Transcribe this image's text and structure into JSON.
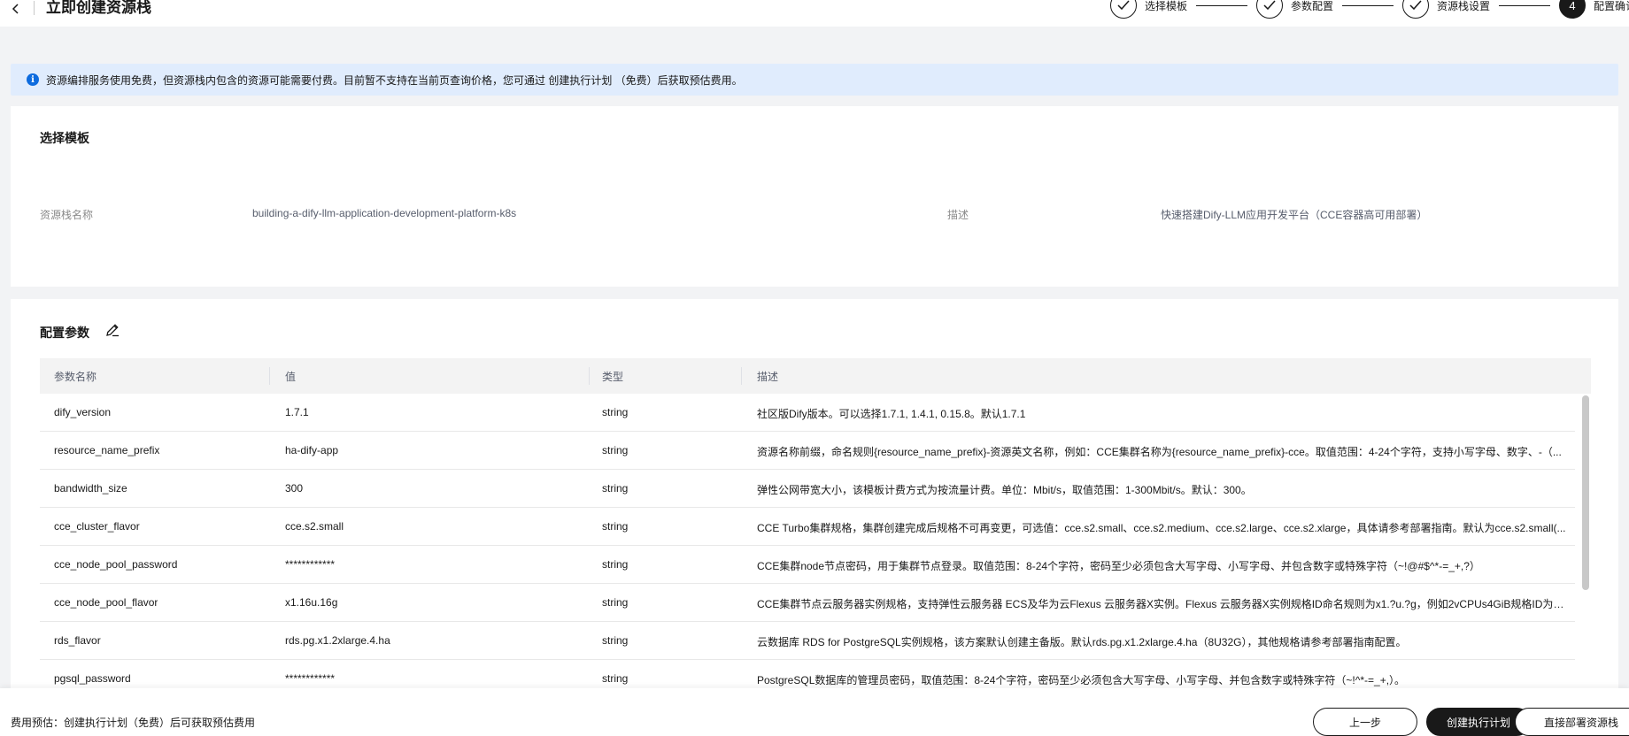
{
  "header": {
    "title": "立即创建资源栈",
    "steps": [
      {
        "label": "选择模板",
        "state": "done"
      },
      {
        "label": "参数配置",
        "state": "done"
      },
      {
        "label": "资源栈设置",
        "state": "done"
      },
      {
        "label": "配置确认",
        "number": "4",
        "state": "active"
      }
    ]
  },
  "banner": {
    "text": "资源编排服务使用免费，但资源栈内包含的资源可能需要付费。目前暂不支持在当前页查询价格，您可通过 创建执行计划 （免费）后获取预估费用。"
  },
  "template_section": {
    "title": "选择模板",
    "stack_name_label": "资源栈名称",
    "stack_name_value": "building-a-dify-llm-application-development-platform-k8s",
    "desc_label": "描述",
    "desc_value": "快速搭建Dify-LLM应用开发平台（CCE容器高可用部署）"
  },
  "params_section": {
    "title": "配置参数",
    "columns": [
      "参数名称",
      "值",
      "类型",
      "描述"
    ],
    "rows": [
      {
        "name": "dify_version",
        "value": "1.7.1",
        "type": "string",
        "desc": "社区版Dify版本。可以选择1.7.1, 1.4.1, 0.15.8。默认1.7.1"
      },
      {
        "name": "resource_name_prefix",
        "value": "ha-dify-app",
        "type": "string",
        "desc": "资源名称前缀，命名规则{resource_name_prefix}-资源英文名称，例如：CCE集群名称为{resource_name_prefix}-cce。取值范围：4-24个字符，支持小写字母、数字、-（..."
      },
      {
        "name": "bandwidth_size",
        "value": "300",
        "type": "string",
        "desc": "弹性公网带宽大小，该模板计费方式为按流量计费。单位：Mbit/s，取值范围：1-300Mbit/s。默认：300。"
      },
      {
        "name": "cce_cluster_flavor",
        "value": "cce.s2.small",
        "type": "string",
        "desc": "CCE Turbo集群规格，集群创建完成后规格不可再变更，可选值：cce.s2.small、cce.s2.medium、cce.s2.large、cce.s2.xlarge，具体请参考部署指南。默认为cce.s2.small(..."
      },
      {
        "name": "cce_node_pool_password",
        "value": "************",
        "type": "string",
        "desc": "CCE集群node节点密码，用于集群节点登录。取值范围：8-24个字符，密码至少必须包含大写字母、小写字母、并包含数字或特殊字符（~!@#$^*-=_+,?）"
      },
      {
        "name": "cce_node_pool_flavor",
        "value": "x1.16u.16g",
        "type": "string",
        "desc": "CCE集群节点云服务器实例规格，支持弹性云服务器 ECS及华为云Flexus 云服务器X实例。Flexus 云服务器X实例规格ID命名规则为x1.?u.?g，例如2vCPUs4GiB规格ID为x..."
      },
      {
        "name": "rds_flavor",
        "value": "rds.pg.x1.2xlarge.4.ha",
        "type": "string",
        "desc": "云数据库 RDS for PostgreSQL实例规格，该方案默认创建主备版。默认rds.pg.x1.2xlarge.4.ha（8U32G），其他规格请参考部署指南配置。"
      },
      {
        "name": "pgsql_password",
        "value": "************",
        "type": "string",
        "desc": "PostgreSQL数据库的管理员密码，取值范围：8-24个字符，密码至少必须包含大写字母、小写字母、并包含数字或特殊字符（~!^*-=_+,）。"
      }
    ]
  },
  "footer": {
    "cost_text": "费用预估：创建执行计划（免费）后可获取预估费用",
    "prev_label": "上一步",
    "plan_label": "创建执行计划",
    "deploy_label": "直接部署资源栈"
  }
}
